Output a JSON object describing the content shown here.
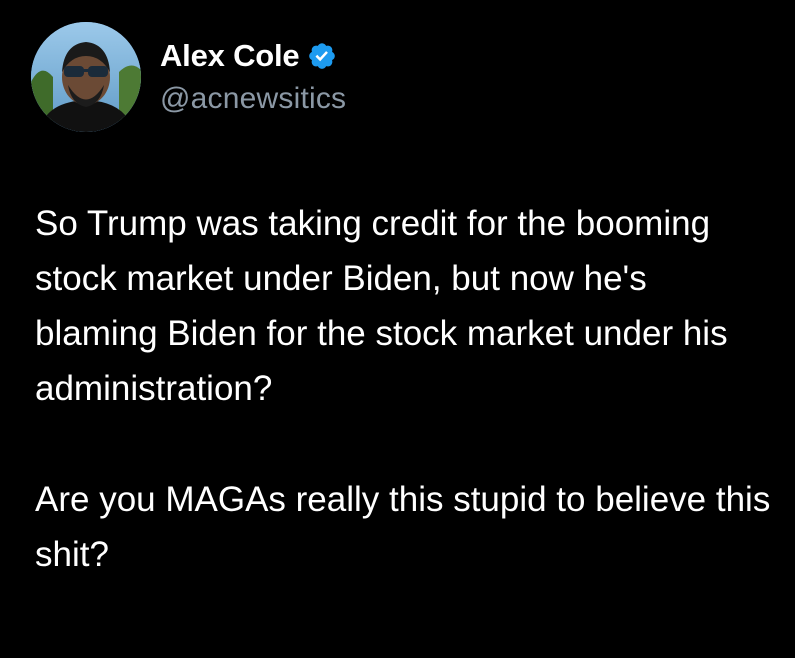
{
  "colors": {
    "background": "#000000",
    "text": "#ffffff",
    "handle": "#8b98a5",
    "verified_badge": "#1d9bf0"
  },
  "author": {
    "display_name": "Alex Cole",
    "handle": "@acnewsitics",
    "verified": true,
    "verified_icon": "verified-badge-icon",
    "avatar_icon": "profile-avatar"
  },
  "tweet": {
    "paragraphs": [
      "So Trump was taking credit for the booming stock market under Biden, but now he's blaming Biden for the stock market under his administration?",
      "Are you MAGAs really this stupid to believe this shit?"
    ]
  }
}
